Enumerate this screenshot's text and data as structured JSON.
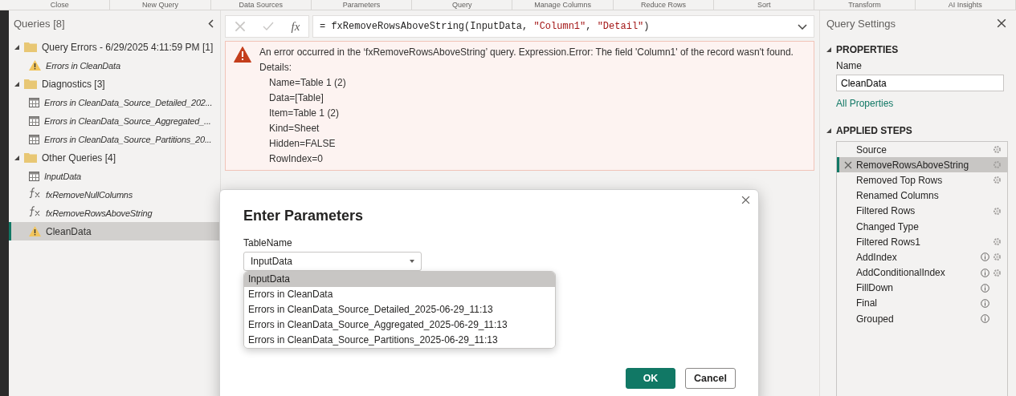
{
  "ribbon_groups": [
    "Close",
    "New Query",
    "Data Sources",
    "Parameters",
    "Query",
    "Manage Columns",
    "Reduce Rows",
    "Sort",
    "Transform",
    "AI Insights"
  ],
  "queries_pane": {
    "title": "Queries [8]",
    "items": [
      {
        "kind": "folder",
        "label": "Query Errors - 6/29/2025 4:11:59 PM [1]",
        "expanded": true,
        "selected": false,
        "children": [
          {
            "kind": "error",
            "label": "Errors in CleanData",
            "italic": true,
            "selected": false
          }
        ]
      },
      {
        "kind": "folder",
        "label": "Diagnostics [3]",
        "expanded": true,
        "selected": false,
        "children": [
          {
            "kind": "table",
            "label": "Errors in CleanData_Source_Detailed_202...",
            "italic": true,
            "selected": false
          },
          {
            "kind": "table",
            "label": "Errors in CleanData_Source_Aggregated_...",
            "italic": true,
            "selected": false
          },
          {
            "kind": "table",
            "label": "Errors in CleanData_Source_Partitions_20...",
            "italic": true,
            "selected": false
          }
        ]
      },
      {
        "kind": "folder",
        "label": "Other Queries [4]",
        "expanded": true,
        "selected": false,
        "children": [
          {
            "kind": "table",
            "label": "InputData",
            "italic": true,
            "selected": false
          },
          {
            "kind": "function",
            "label": "fxRemoveNullColumns",
            "italic": true,
            "selected": false
          },
          {
            "kind": "function",
            "label": "fxRemoveRowsAboveString",
            "italic": true,
            "selected": false
          },
          {
            "kind": "error",
            "label": "CleanData",
            "italic": false,
            "selected": true
          }
        ]
      }
    ]
  },
  "formula_bar": {
    "fx": "fx",
    "tokens": [
      {
        "kind": "code",
        "text": "= fxRemoveRowsAboveString(InputData, "
      },
      {
        "kind": "string",
        "text": "\"Column1\""
      },
      {
        "kind": "code",
        "text": ", "
      },
      {
        "kind": "string",
        "text": "\"Detail\""
      },
      {
        "kind": "code",
        "text": ")"
      }
    ]
  },
  "error": {
    "message": "An error occurred in the ‘fxRemoveRowsAboveString’ query. Expression.Error: The field 'Column1' of the record wasn't found.",
    "details_label": "Details:",
    "details": [
      "Name=Table 1 (2)",
      "Data=[Table]",
      "Item=Table 1 (2)",
      "Kind=Sheet",
      "Hidden=FALSE",
      "RowIndex=0"
    ]
  },
  "dialog": {
    "title": "Enter Parameters",
    "field_label": "TableName",
    "value": "InputData",
    "options": [
      {
        "label": "InputData",
        "selected": true
      },
      {
        "label": "Errors in CleanData",
        "selected": false
      },
      {
        "label": "Errors in CleanData_Source_Detailed_2025-06-29_11:13",
        "selected": false
      },
      {
        "label": "Errors in CleanData_Source_Aggregated_2025-06-29_11:13",
        "selected": false
      },
      {
        "label": "Errors in CleanData_Source_Partitions_2025-06-29_11:13",
        "selected": false
      }
    ],
    "buttons": [
      {
        "label": "OK",
        "kind": "primary"
      },
      {
        "label": "Cancel",
        "kind": "secondary"
      }
    ]
  },
  "settings": {
    "title": "Query Settings",
    "properties_heading": "PROPERTIES",
    "name_label": "Name",
    "name_value": "CleanData",
    "all_properties": "All Properties",
    "steps_heading": "APPLIED STEPS",
    "steps": [
      {
        "label": "Source",
        "selected": false,
        "error": false,
        "info": false,
        "gear": true
      },
      {
        "label": "RemoveRowsAboveString",
        "selected": true,
        "error": true,
        "info": false,
        "gear": true
      },
      {
        "label": "Removed Top Rows",
        "selected": false,
        "error": false,
        "info": false,
        "gear": true
      },
      {
        "label": "Renamed Columns",
        "selected": false,
        "error": false,
        "info": false,
        "gear": false
      },
      {
        "label": "Filtered Rows",
        "selected": false,
        "error": false,
        "info": false,
        "gear": true
      },
      {
        "label": "Changed Type",
        "selected": false,
        "error": false,
        "info": false,
        "gear": false
      },
      {
        "label": "Filtered Rows1",
        "selected": false,
        "error": false,
        "info": false,
        "gear": true
      },
      {
        "label": "AddIndex",
        "selected": false,
        "error": false,
        "info": true,
        "gear": true
      },
      {
        "label": "AddConditionalIndex",
        "selected": false,
        "error": false,
        "info": true,
        "gear": true
      },
      {
        "label": "FillDown",
        "selected": false,
        "error": false,
        "info": true,
        "gear": false
      },
      {
        "label": "Final",
        "selected": false,
        "error": false,
        "info": true,
        "gear": false
      },
      {
        "label": "Grouped",
        "selected": false,
        "error": false,
        "info": true,
        "gear": false
      }
    ]
  }
}
